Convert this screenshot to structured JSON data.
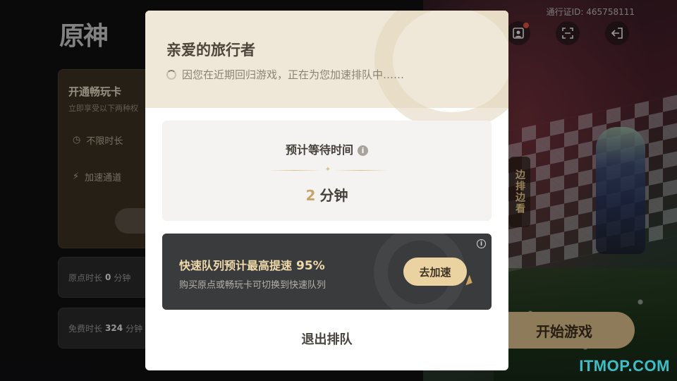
{
  "background": {
    "logo": "原神",
    "pass_id": "通行证ID: 465758111",
    "icons": [
      "profile-icon",
      "scan-icon",
      "logout-icon"
    ],
    "pass_card": {
      "title": "开通畅玩卡",
      "subtitle": "立即享受以下两种权",
      "benefits": [
        {
          "icon": "clock-icon",
          "label": "不限时长"
        },
        {
          "icon": "lightning-icon",
          "label": "加速通道"
        }
      ]
    },
    "origin_time": {
      "label": "原点时长",
      "value": "0",
      "unit": "分钟"
    },
    "free_time": {
      "label": "免费时长",
      "value": "324",
      "unit": "分钟"
    },
    "start_button": "开始游戏",
    "side_tab": "边排边看",
    "watermark": "ITMOP.COM"
  },
  "dialog": {
    "title": "亲爱的旅行者",
    "status": "因您在近期回归游戏，正在为您加速排队中……",
    "wait_label": "预计等待时间",
    "wait_value": "2",
    "wait_unit": "分钟",
    "fast_queue": {
      "title": "快速队列预计最高提速",
      "percent": "95%",
      "subtitle": "购买原点或畅玩卡可切换到快速队列",
      "button": "去加速"
    },
    "exit_button": "退出排队"
  },
  "colors": {
    "accent_gold": "#c9a468",
    "button_gold": "#ead3a0",
    "header_beige": "#efe8d8",
    "dark_panel": "#3a3b3d"
  }
}
